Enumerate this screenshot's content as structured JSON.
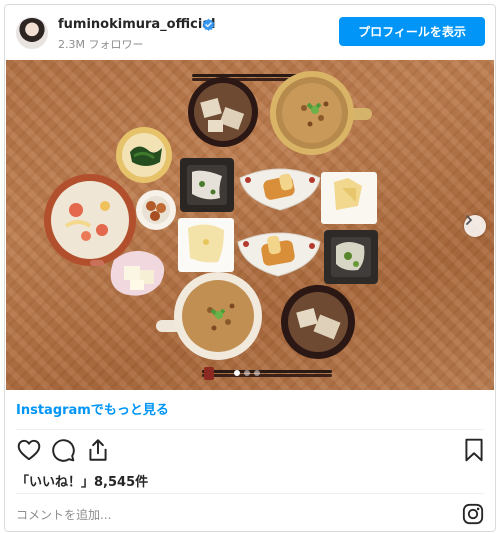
{
  "header": {
    "username": "fuminokimura_official",
    "followers": "2.3M フォロワー",
    "profile_button": "プロフィールを表示"
  },
  "post": {
    "image_alt": "和食の食卓",
    "carousel_count": 3,
    "carousel_active": 1
  },
  "more_link": "Instagramでもっと見る",
  "actions": {
    "like_icon": "heart-icon",
    "comment_icon": "comment-icon",
    "share_icon": "share-icon",
    "save_icon": "bookmark-icon"
  },
  "likes_text": "「いいね！」8,545件",
  "comment": {
    "placeholder": "コメントを追加..."
  },
  "colors": {
    "accent": "#0095f6",
    "text": "#262626",
    "muted": "#8e8e8e"
  }
}
